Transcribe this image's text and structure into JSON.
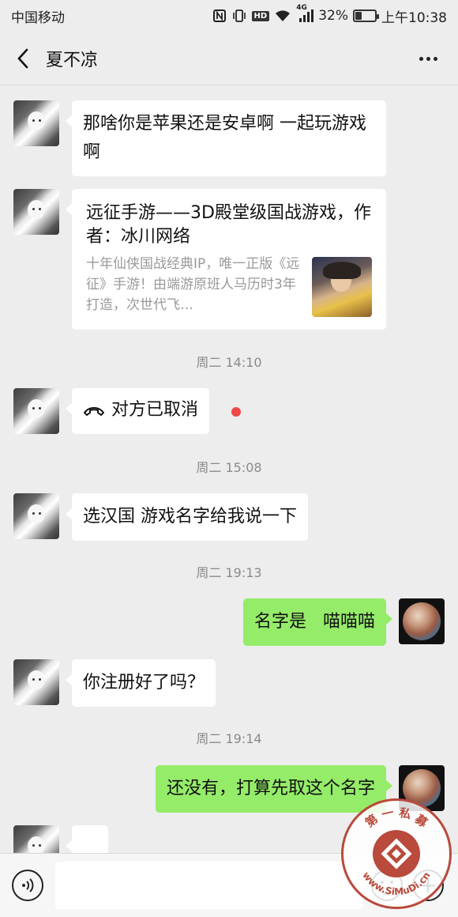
{
  "status_bar": {
    "carrier": "中国移动",
    "network": "4G",
    "hd": "HD",
    "battery_percent_text": "32%",
    "battery_level": 0.32,
    "time": "上午10:38"
  },
  "header": {
    "contact_name": "夏不凉"
  },
  "messages": {
    "m1": {
      "text": "那啥你是苹果还是安卓啊 一起玩游戏啊"
    },
    "m2": {
      "title": "远征手游——3D殿堂级国战游戏，作者：冰川网络",
      "description": "十年仙侠国战经典IP，唯一正版《远征》手游！由端游原班人马历时3年打造，次世代飞…"
    },
    "t1": "周二 14:10",
    "m3": {
      "text": "对方已取消"
    },
    "t2": "周二 15:08",
    "m4": {
      "text": "选汉国  游戏名字给我说一下"
    },
    "t3": "周二 19:13",
    "m5": {
      "text": "名字是   喵喵喵"
    },
    "m6": {
      "text": "你注册好了吗？"
    },
    "t4": "周二 19:14",
    "m7": {
      "text": "还没有，打算先取这个名字"
    }
  },
  "input": {
    "placeholder": ""
  },
  "watermark": {
    "text_top": "第 一 私 募",
    "text_bottom": "www.SiMuDi.cn"
  },
  "colors": {
    "background": "#ededed",
    "sent_bubble": "#95ec69",
    "received_bubble": "#ffffff",
    "unread_dot": "#f04848",
    "stamp": "#b94a3c"
  }
}
